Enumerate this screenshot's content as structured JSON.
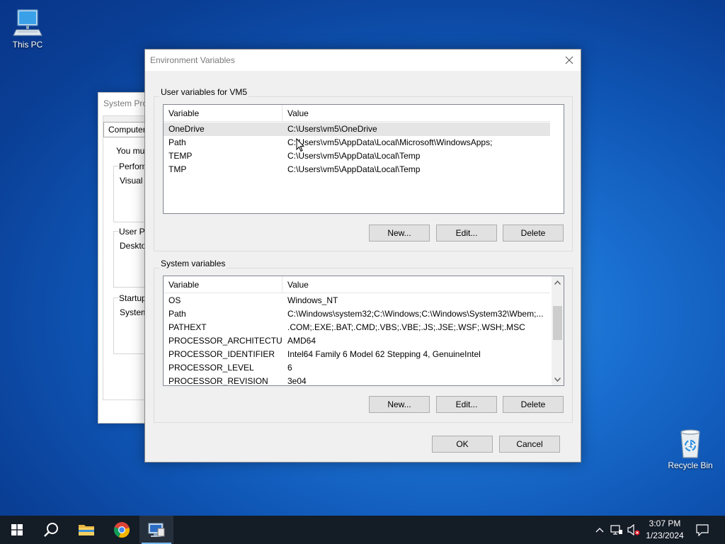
{
  "desktop": {
    "icons": [
      {
        "label": "This PC"
      },
      {
        "label": "Recycle Bin"
      }
    ]
  },
  "system_properties": {
    "title": "System Pro",
    "tab": "Computer N",
    "note": "You mus",
    "groups": [
      {
        "label": "Perform",
        "text": "Visual e"
      },
      {
        "label": "User Pr",
        "text": "Desktop"
      },
      {
        "label": "Startup",
        "text": "System"
      }
    ]
  },
  "env_dialog": {
    "title": "Environment Variables",
    "user_group_label": "User variables for VM5",
    "system_group_label": "System variables",
    "columns": {
      "variable": "Variable",
      "value": "Value"
    },
    "user_vars": [
      {
        "variable": "OneDrive",
        "value": "C:\\Users\\vm5\\OneDrive"
      },
      {
        "variable": "Path",
        "value": "C:\\Users\\vm5\\AppData\\Local\\Microsoft\\WindowsApps;"
      },
      {
        "variable": "TEMP",
        "value": "C:\\Users\\vm5\\AppData\\Local\\Temp"
      },
      {
        "variable": "TMP",
        "value": "C:\\Users\\vm5\\AppData\\Local\\Temp"
      }
    ],
    "system_vars": [
      {
        "variable": "OS",
        "value": "Windows_NT"
      },
      {
        "variable": "Path",
        "value": "C:\\Windows\\system32;C:\\Windows;C:\\Windows\\System32\\Wbem;..."
      },
      {
        "variable": "PATHEXT",
        "value": ".COM;.EXE;.BAT;.CMD;.VBS;.VBE;.JS;.JSE;.WSF;.WSH;.MSC"
      },
      {
        "variable": "PROCESSOR_ARCHITECTURE",
        "value": "AMD64"
      },
      {
        "variable": "PROCESSOR_IDENTIFIER",
        "value": "Intel64 Family 6 Model 62 Stepping 4, GenuineIntel"
      },
      {
        "variable": "PROCESSOR_LEVEL",
        "value": "6"
      },
      {
        "variable": "PROCESSOR_REVISION",
        "value": "3e04"
      }
    ],
    "buttons": {
      "user_new": "New...",
      "user_edit": "Edit...",
      "user_delete": "Delete",
      "system_new": "New...",
      "system_edit": "Edit...",
      "system_delete": "Delete",
      "ok": "OK",
      "cancel": "Cancel"
    },
    "icons": {
      "close": "close-icon",
      "scroll_up": "chevron-up-icon",
      "scroll_down": "chevron-down-icon"
    }
  },
  "taskbar": {
    "clock_time": "3:07 PM",
    "clock_date": "1/23/2024",
    "apps": [
      "start-icon",
      "search-icon",
      "file-explorer-icon",
      "chrome-icon",
      "system-properties-icon"
    ],
    "tray": [
      "chevron-up-icon",
      "network-icon",
      "volume-muted-icon",
      "notification-icon"
    ]
  },
  "colors": {
    "accent": "#76b9ed",
    "selection": "#e5e5e5",
    "taskbar": "#141c26"
  }
}
